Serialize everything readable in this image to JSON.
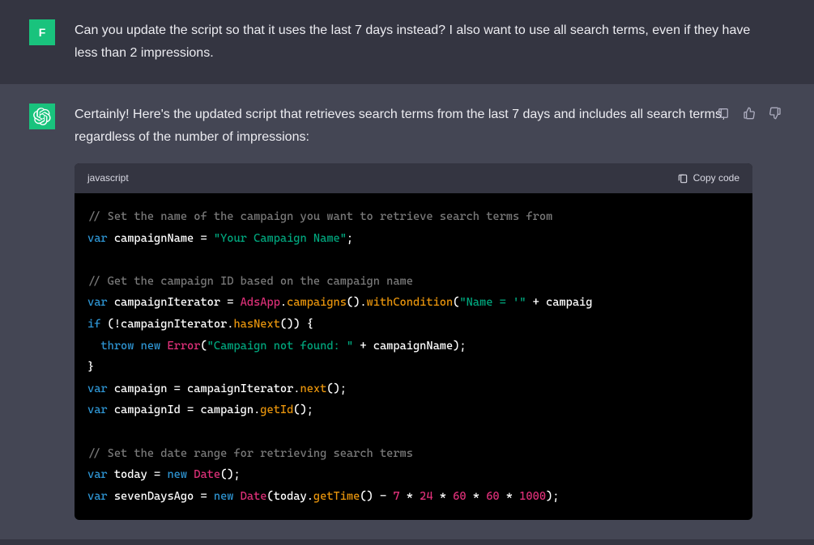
{
  "user": {
    "avatar_letter": "F",
    "message": "Can you update the script so that it uses the last 7 days instead? I also want to use all search terms, even if they have less than 2 impressions."
  },
  "assistant": {
    "message": "Certainly! Here's the updated script that retrieves search terms from the last 7 days and includes all search terms, regardless of the number of impressions:",
    "code_language": "javascript",
    "copy_label": "Copy code",
    "code_tokens": [
      [
        {
          "t": "c",
          "v": "// Set the name of the campaign you want to retrieve search terms from"
        }
      ],
      [
        {
          "t": "kw",
          "v": "var"
        },
        {
          "t": "op",
          "v": " "
        },
        {
          "t": "id",
          "v": "campaignName"
        },
        {
          "t": "op",
          "v": " = "
        },
        {
          "t": "str",
          "v": "\"Your Campaign Name\""
        },
        {
          "t": "op",
          "v": ";"
        }
      ],
      [],
      [
        {
          "t": "c",
          "v": "// Get the campaign ID based on the campaign name"
        }
      ],
      [
        {
          "t": "kw",
          "v": "var"
        },
        {
          "t": "op",
          "v": " "
        },
        {
          "t": "id",
          "v": "campaignIterator"
        },
        {
          "t": "op",
          "v": " = "
        },
        {
          "t": "cls",
          "v": "AdsApp"
        },
        {
          "t": "op",
          "v": "."
        },
        {
          "t": "fn",
          "v": "campaigns"
        },
        {
          "t": "op",
          "v": "()."
        },
        {
          "t": "fn",
          "v": "withCondition"
        },
        {
          "t": "op",
          "v": "("
        },
        {
          "t": "str",
          "v": "\"Name = '\""
        },
        {
          "t": "op",
          "v": " + campaig"
        }
      ],
      [
        {
          "t": "kw",
          "v": "if"
        },
        {
          "t": "op",
          "v": " (!campaignIterator."
        },
        {
          "t": "fn",
          "v": "hasNext"
        },
        {
          "t": "op",
          "v": "()) {"
        }
      ],
      [
        {
          "t": "op",
          "v": "  "
        },
        {
          "t": "kw",
          "v": "throw"
        },
        {
          "t": "op",
          "v": " "
        },
        {
          "t": "kw",
          "v": "new"
        },
        {
          "t": "op",
          "v": " "
        },
        {
          "t": "cls",
          "v": "Error"
        },
        {
          "t": "op",
          "v": "("
        },
        {
          "t": "str",
          "v": "\"Campaign not found: \""
        },
        {
          "t": "op",
          "v": " + campaignName);"
        }
      ],
      [
        {
          "t": "op",
          "v": "}"
        }
      ],
      [
        {
          "t": "kw",
          "v": "var"
        },
        {
          "t": "op",
          "v": " "
        },
        {
          "t": "id",
          "v": "campaign"
        },
        {
          "t": "op",
          "v": " = campaignIterator."
        },
        {
          "t": "fn",
          "v": "next"
        },
        {
          "t": "op",
          "v": "();"
        }
      ],
      [
        {
          "t": "kw",
          "v": "var"
        },
        {
          "t": "op",
          "v": " "
        },
        {
          "t": "id",
          "v": "campaignId"
        },
        {
          "t": "op",
          "v": " = campaign."
        },
        {
          "t": "fn",
          "v": "getId"
        },
        {
          "t": "op",
          "v": "();"
        }
      ],
      [],
      [
        {
          "t": "c",
          "v": "// Set the date range for retrieving search terms"
        }
      ],
      [
        {
          "t": "kw",
          "v": "var"
        },
        {
          "t": "op",
          "v": " "
        },
        {
          "t": "id",
          "v": "today"
        },
        {
          "t": "op",
          "v": " = "
        },
        {
          "t": "kw",
          "v": "new"
        },
        {
          "t": "op",
          "v": " "
        },
        {
          "t": "cls",
          "v": "Date"
        },
        {
          "t": "op",
          "v": "();"
        }
      ],
      [
        {
          "t": "kw",
          "v": "var"
        },
        {
          "t": "op",
          "v": " "
        },
        {
          "t": "id",
          "v": "sevenDaysAgo"
        },
        {
          "t": "op",
          "v": " = "
        },
        {
          "t": "kw",
          "v": "new"
        },
        {
          "t": "op",
          "v": " "
        },
        {
          "t": "cls",
          "v": "Date"
        },
        {
          "t": "op",
          "v": "(today."
        },
        {
          "t": "fn",
          "v": "getTime"
        },
        {
          "t": "op",
          "v": "() - "
        },
        {
          "t": "num",
          "v": "7"
        },
        {
          "t": "op",
          "v": " * "
        },
        {
          "t": "num",
          "v": "24"
        },
        {
          "t": "op",
          "v": " * "
        },
        {
          "t": "num",
          "v": "60"
        },
        {
          "t": "op",
          "v": " * "
        },
        {
          "t": "num",
          "v": "60"
        },
        {
          "t": "op",
          "v": " * "
        },
        {
          "t": "num",
          "v": "1000"
        },
        {
          "t": "op",
          "v": ");"
        }
      ]
    ]
  }
}
